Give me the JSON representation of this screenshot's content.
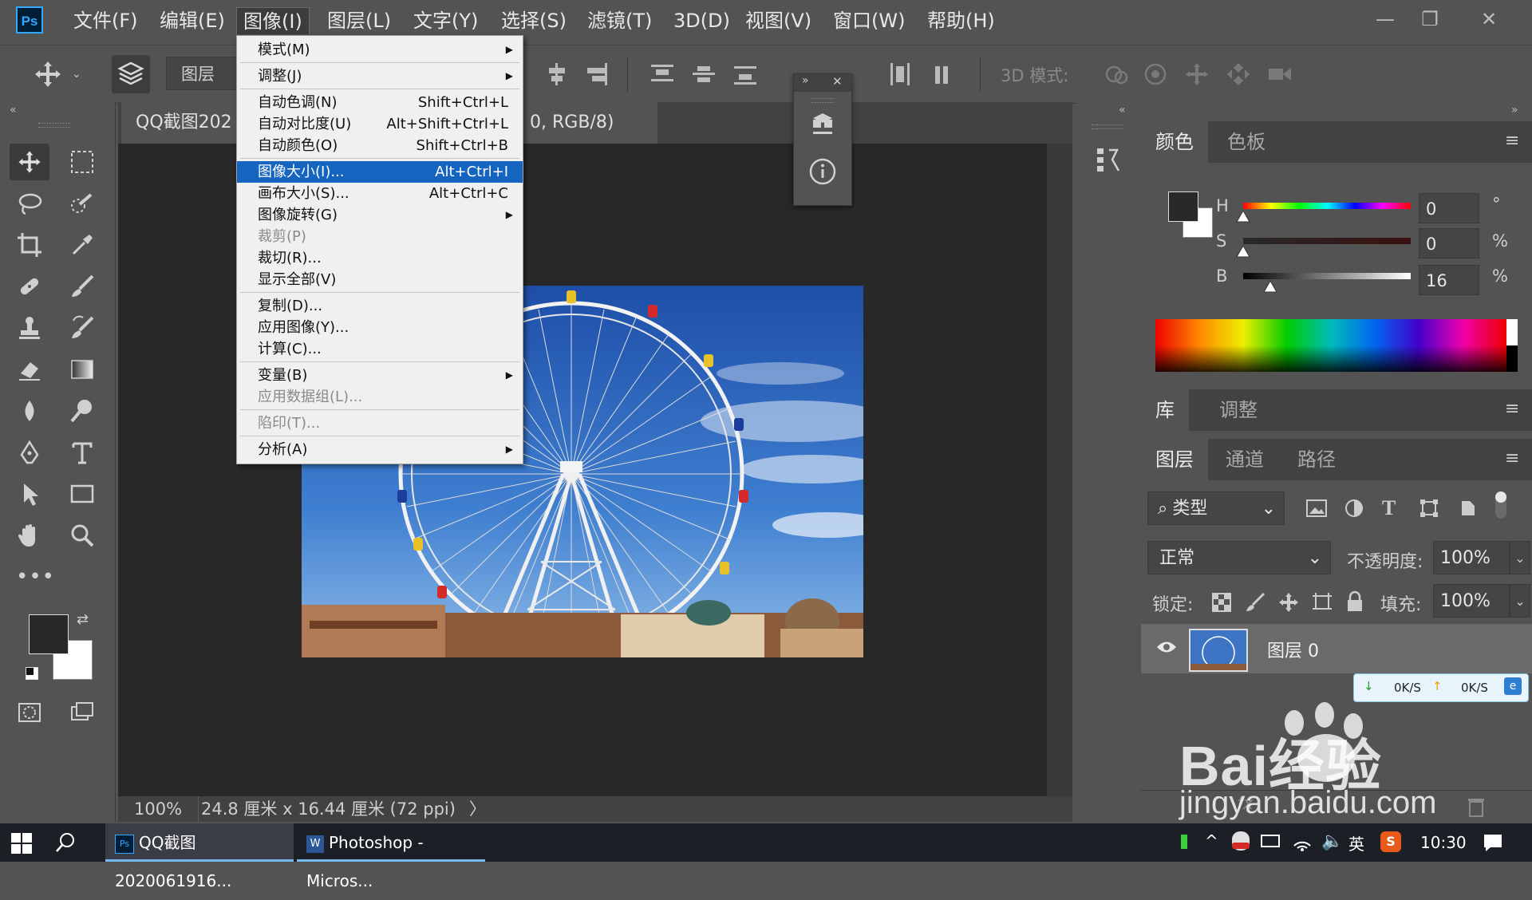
{
  "app": {
    "logo": "Ps"
  },
  "menubar": {
    "items": [
      "文件(F)",
      "编辑(E)",
      "图像(I)",
      "图层(L)",
      "文字(Y)",
      "选择(S)",
      "滤镜(T)",
      "3D(D)",
      "视图(V)",
      "窗口(W)",
      "帮助(H)"
    ],
    "active_index": 2
  },
  "options_bar": {
    "layer_select": "图层",
    "mode_3d_label": "3D 模式:"
  },
  "document": {
    "tab_left": "QQ截图202",
    "tab_right": "0, RGB/8)",
    "tab_close": "×",
    "zoom": "100%",
    "doc_info": "24.8 厘米 x 16.44 厘米 (72 ppi)",
    "info_arrow": "〉"
  },
  "image_menu": {
    "items": [
      {
        "label": "模式(M)",
        "shortcut": "",
        "submenu": true,
        "disabled": false
      },
      {
        "sep": true
      },
      {
        "label": "调整(J)",
        "shortcut": "",
        "submenu": true,
        "disabled": false
      },
      {
        "sep": true
      },
      {
        "label": "自动色调(N)",
        "shortcut": "Shift+Ctrl+L",
        "submenu": false,
        "disabled": false
      },
      {
        "label": "自动对比度(U)",
        "shortcut": "Alt+Shift+Ctrl+L",
        "submenu": false,
        "disabled": false
      },
      {
        "label": "自动颜色(O)",
        "shortcut": "Shift+Ctrl+B",
        "submenu": false,
        "disabled": false
      },
      {
        "sep": true
      },
      {
        "label": "图像大小(I)...",
        "shortcut": "Alt+Ctrl+I",
        "submenu": false,
        "disabled": false,
        "highlighted": true
      },
      {
        "label": "画布大小(S)...",
        "shortcut": "Alt+Ctrl+C",
        "submenu": false,
        "disabled": false
      },
      {
        "label": "图像旋转(G)",
        "shortcut": "",
        "submenu": true,
        "disabled": false
      },
      {
        "label": "裁剪(P)",
        "shortcut": "",
        "submenu": false,
        "disabled": true
      },
      {
        "label": "裁切(R)...",
        "shortcut": "",
        "submenu": false,
        "disabled": false
      },
      {
        "label": "显示全部(V)",
        "shortcut": "",
        "submenu": false,
        "disabled": false
      },
      {
        "sep": true
      },
      {
        "label": "复制(D)...",
        "shortcut": "",
        "submenu": false,
        "disabled": false
      },
      {
        "label": "应用图像(Y)...",
        "shortcut": "",
        "submenu": false,
        "disabled": false
      },
      {
        "label": "计算(C)...",
        "shortcut": "",
        "submenu": false,
        "disabled": false
      },
      {
        "sep": true
      },
      {
        "label": "变量(B)",
        "shortcut": "",
        "submenu": true,
        "disabled": false
      },
      {
        "label": "应用数据组(L)...",
        "shortcut": "",
        "submenu": false,
        "disabled": true
      },
      {
        "sep": true
      },
      {
        "label": "陷印(T)...",
        "shortcut": "",
        "submenu": false,
        "disabled": true
      },
      {
        "sep": true
      },
      {
        "label": "分析(A)",
        "shortcut": "",
        "submenu": true,
        "disabled": false
      }
    ]
  },
  "color_panel": {
    "tabs": [
      "颜色",
      "色板"
    ],
    "h_label": "H",
    "s_label": "S",
    "b_label": "B",
    "h_value": "0",
    "s_value": "0",
    "b_value": "16",
    "h_unit": "°",
    "s_unit": "%",
    "b_unit": "%",
    "foreground": "#292929",
    "background": "#ffffff"
  },
  "library_panel": {
    "tabs": [
      "库",
      "调整"
    ]
  },
  "layers_panel": {
    "tabs": [
      "图层",
      "通道",
      "路径"
    ],
    "filter_label": "类型",
    "blend_mode": "正常",
    "opacity_label": "不透明度:",
    "opacity_value": "100%",
    "lock_label": "锁定:",
    "fill_label": "填充:",
    "fill_value": "100%",
    "layer_name": "图层 0"
  },
  "net_widget": {
    "down": "0K/S",
    "up": "0K/S"
  },
  "watermark": {
    "brand": "Bai经验",
    "url": "jingyan.baidu.com"
  },
  "taskbar": {
    "app1": "QQ截图2020061916...",
    "app2": "Photoshop - Micros...",
    "ime": "英",
    "clock": "10:30"
  },
  "colors": {
    "accent_highlight": "#1565c0",
    "ps_blue": "#31a8ff"
  }
}
